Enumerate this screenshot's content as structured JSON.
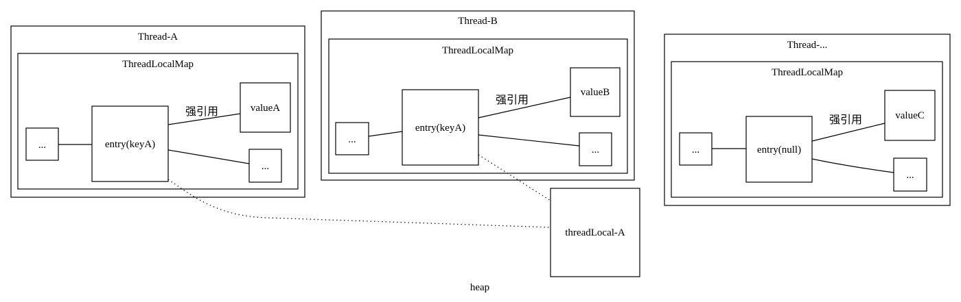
{
  "threads": [
    {
      "id": "a",
      "title": "Thread-A",
      "map_title": "ThreadLocalMap",
      "entry_label": "entry(keyA)",
      "left_node_label": "...",
      "value_label": "valueA",
      "other_node_label": "...",
      "edge_label": "强引用"
    },
    {
      "id": "b",
      "title": "Thread-B",
      "map_title": "ThreadLocalMap",
      "entry_label": "entry(keyA)",
      "left_node_label": "...",
      "value_label": "valueB",
      "other_node_label": "...",
      "edge_label": "强引用"
    },
    {
      "id": "c",
      "title": "Thread-...",
      "map_title": "ThreadLocalMap",
      "entry_label": "entry(null)",
      "left_node_label": "...",
      "value_label": "valueC",
      "other_node_label": "...",
      "edge_label": "强引用"
    }
  ],
  "thread_local": {
    "label": "threadLocal-A"
  },
  "heap_label": "heap"
}
